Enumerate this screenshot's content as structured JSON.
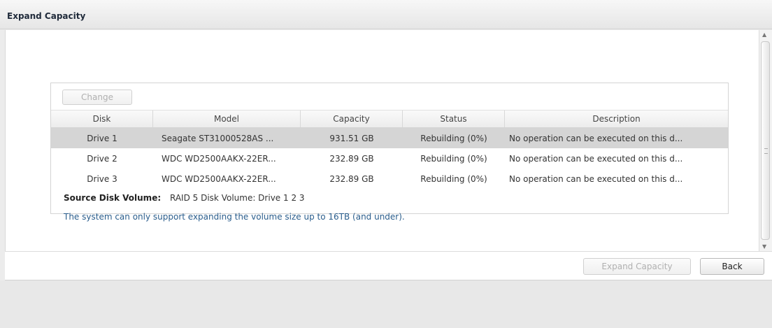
{
  "window": {
    "title": "Expand Capacity"
  },
  "toolbar": {
    "change_label": "Change"
  },
  "table": {
    "columns": [
      "Disk",
      "Model",
      "Capacity",
      "Status",
      "Description"
    ],
    "rows": [
      {
        "disk": "Drive 1",
        "model": "Seagate ST31000528AS ...",
        "capacity": "931.51 GB",
        "status": "Rebuilding (0%)",
        "description": "No operation can be executed on this d..."
      },
      {
        "disk": "Drive 2",
        "model": "WDC WD2500AAKX-22ER...",
        "capacity": "232.89 GB",
        "status": "Rebuilding (0%)",
        "description": "No operation can be executed on this d..."
      },
      {
        "disk": "Drive 3",
        "model": "WDC WD2500AAKX-22ER...",
        "capacity": "232.89 GB",
        "status": "Rebuilding (0%)",
        "description": "No operation can be executed on this d..."
      }
    ]
  },
  "source": {
    "label": "Source Disk Volume:",
    "value": "RAID 5 Disk Volume: Drive 1 2 3"
  },
  "notice": "The system can only support expanding the volume size up to 16TB (and under).",
  "footer": {
    "expand_label": "Expand Capacity",
    "back_label": "Back"
  },
  "colors": {
    "selected_row": "#d5d5d5",
    "notice_text": "#2a5d8c"
  }
}
